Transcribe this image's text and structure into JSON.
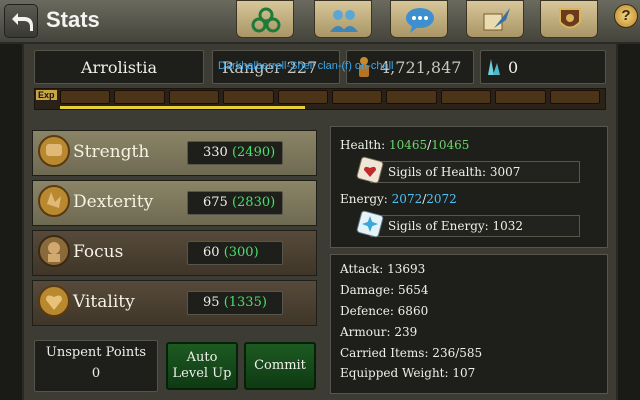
{
  "header": {
    "title": "Stats",
    "tabs": [
      {
        "name": "talents",
        "icon": "triskele-icon"
      },
      {
        "name": "social",
        "icon": "people-icon"
      },
      {
        "name": "chat",
        "icon": "speech-bubble-icon"
      },
      {
        "name": "quests",
        "icon": "quill-scroll-icon"
      },
      {
        "name": "guild",
        "icon": "shield-banner-icon"
      }
    ],
    "help_label": "?"
  },
  "character": {
    "name": "Arrolistia",
    "level": "Ranger 227",
    "gold": "4,721,847",
    "gems": "0",
    "clan_overlay": "Darkhalberrell-Shell clan-(f) on-chall"
  },
  "exp": {
    "label": "Exp",
    "segments": 10,
    "progress": 0.45
  },
  "stats": [
    {
      "name": "Strength",
      "value": "330",
      "bonus": "(2490)",
      "icon": "fist-icon"
    },
    {
      "name": "Dexterity",
      "value": "675",
      "bonus": "(2830)",
      "icon": "hand-icon"
    },
    {
      "name": "Focus",
      "value": "60",
      "bonus": "(300)",
      "icon": "eye-head-icon"
    },
    {
      "name": "Vitality",
      "value": "95",
      "bonus": "(1335)",
      "icon": "heart-flame-icon"
    }
  ],
  "points": {
    "label": "Unspent Points",
    "value": "0"
  },
  "buttons": {
    "auto_line1": "Auto",
    "auto_line2": "Level Up",
    "commit": "Commit"
  },
  "vitals": {
    "health_label": "Health:",
    "health_current": "10465",
    "health_max": "10465",
    "sigils_health": "Sigils of Health: 3007",
    "energy_label": "Energy:",
    "energy_current": "2072",
    "energy_max": "2072",
    "sigils_energy": "Sigils of Energy: 1032"
  },
  "derived": [
    "Attack: 13693",
    "Damage: 5654",
    "Defence: 6860",
    "Armour: 239",
    "Carried Items: 236/585",
    "Equipped Weight: 107"
  ],
  "colors": {
    "accent_green": "#4be06a",
    "energy_blue": "#4fc1f5",
    "exp_fill": "#e6cf3a"
  }
}
